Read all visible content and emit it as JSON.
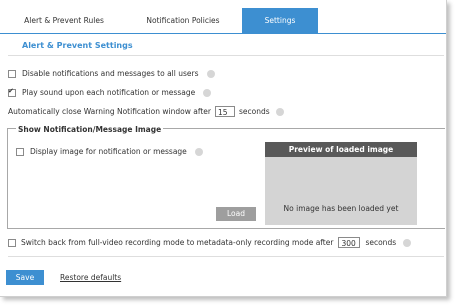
{
  "tabs": [
    {
      "label": "Alert & Prevent Rules",
      "active": false
    },
    {
      "label": "Notification Policies",
      "active": false
    },
    {
      "label": "Settings",
      "active": true
    }
  ],
  "section_title": "Alert & Prevent Settings",
  "options": {
    "disable_notifications": {
      "label": "Disable notifications and messages to all users",
      "checked": false
    },
    "play_sound": {
      "label": "Play sound upon each notification or message",
      "checked": true
    },
    "auto_close": {
      "prefix": "Automatically close Warning Notification window after",
      "value": "15",
      "suffix": "seconds"
    }
  },
  "image_group": {
    "title": "Show Notification/Message Image",
    "display_image": {
      "label": "Display image for notification or message",
      "checked": false
    },
    "load_label": "Load",
    "preview_title": "Preview of loaded image",
    "preview_empty": "No image has been loaded yet"
  },
  "switch_back": {
    "label": "Switch back from full-video recording mode to metadata-only recording mode after",
    "value": "300",
    "suffix": "seconds",
    "checked": false
  },
  "footer": {
    "save_label": "Save",
    "restore_label": "Restore defaults"
  },
  "colors": {
    "accent": "#3d8fd1",
    "preview_header": "#595959",
    "preview_bg": "#d4d4d4",
    "load_button": "#9e9e9e"
  }
}
